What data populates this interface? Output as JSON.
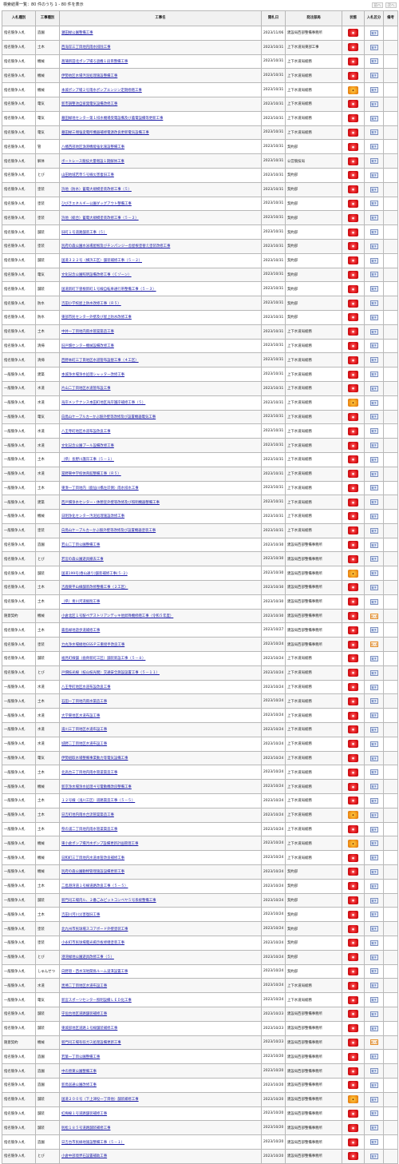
{
  "header": {
    "summary": "検索結果一覧：80 件のうち 1 - 80 件を表示",
    "prev_label": "前へ",
    "next_label": "次へ"
  },
  "columns": {
    "method": "入札種別",
    "type": "工事種別",
    "name": "工事名",
    "date": "開札日",
    "dept": "発注部局",
    "status": "状態",
    "kbn": "入札区分",
    "note": "備考"
  },
  "status_colors": {
    "open": "#e0161b",
    "closed": "#f39a1d"
  },
  "rows": [
    {
      "method": "指名競争入札",
      "type": "造園",
      "name": "瀬田緑公園整備工事",
      "date": "2023/11/06",
      "dept": "建設局西部整備事務所",
      "status": "red",
      "kbn": "電子"
    },
    {
      "method": "指名競争入札",
      "type": "土木",
      "name": "西海岸三丁目地内雨水排除工事",
      "date": "2023/10/31",
      "dept": "上下水道局東部工事",
      "status": "red",
      "kbn": "電子"
    },
    {
      "method": "指名競争入札",
      "type": "機械",
      "name": "菖蒲新田北ポンプ場ろ過機１段目整備工事",
      "date": "2023/10/31",
      "dept": "上下水道局総務",
      "status": "red",
      "kbn": "電子"
    },
    {
      "method": "指名競争入札",
      "type": "機械",
      "name": "伊勢地区水場汚泥処理施設整備工事",
      "date": "2023/10/31",
      "dept": "上下水道局総務",
      "status": "red",
      "kbn": "電子"
    },
    {
      "method": "指名競争入札",
      "type": "機械",
      "name": "本城ポンプ場２号雨水ポンプエンジン定期修繕工事",
      "date": "2023/10/31",
      "dept": "上下水道局総務",
      "status": "orange",
      "kbn": "電子"
    },
    {
      "method": "指名競争入札",
      "type": "電気",
      "name": "新市調整池自家発電気設備改修工事",
      "date": "2023/10/31",
      "dept": "上下水道局総務",
      "status": "red",
      "kbn": "電子"
    },
    {
      "method": "指名競争入札",
      "type": "電気",
      "name": "墓田緑地センター第１排水機場受電設備及び蓄電設備等更新工事",
      "date": "2023/10/31",
      "dept": "上下水道局総務",
      "status": "red",
      "kbn": "電子"
    },
    {
      "method": "指名競争入札",
      "type": "電気",
      "name": "墓田緑三増強変電所機器補修電源改良更新電気設備工事",
      "date": "2023/10/31",
      "dept": "上下水道局総務",
      "status": "red",
      "kbn": "電子"
    },
    {
      "method": "指名競争入札",
      "type": "管",
      "name": "八幡西部地区漁港機能強化施設整備工事",
      "date": "2023/10/31",
      "dept": "契約部",
      "status": "red",
      "kbn": "電子"
    },
    {
      "method": "指名競争入札",
      "type": "解体",
      "name": "ボートレース競技大量増設１期解体工事",
      "date": "2023/10/31",
      "dept": "公営競技局",
      "status": "red",
      "kbn": "電子"
    },
    {
      "method": "指名競争入札",
      "type": "とび",
      "name": "山田地域若草５号線災害復旧工事",
      "date": "2023/10/31",
      "dept": "契約部",
      "status": "red",
      "kbn": "電子"
    },
    {
      "method": "指名競争入札",
      "type": "塗装",
      "name": "浜地（防水）蓄電大規模塗装改修工事（５）",
      "date": "2023/10/31",
      "dept": "契約部",
      "status": "red",
      "kbn": "電子"
    },
    {
      "method": "指名競争入札",
      "type": "塗装",
      "name": "ひびきエネルギー公園ダッグアウト整備工事",
      "date": "2023/10/31",
      "dept": "契約部",
      "status": "red",
      "kbn": "電子"
    },
    {
      "method": "指名競争入札",
      "type": "塗装",
      "name": "浜地（総合）蓄電大規模塗装改修工事（５－２）",
      "date": "2023/10/31",
      "dept": "契約部",
      "status": "red",
      "kbn": "電子"
    },
    {
      "method": "指名競争入札",
      "type": "舗装",
      "name": "旧町１号道路舗装工事（５）",
      "date": "2023/10/31",
      "dept": "契約部",
      "status": "red",
      "kbn": "電子"
    },
    {
      "method": "指名競争入札",
      "type": "塗装",
      "name": "別府の森公園水泳場屋根及びチンパンジー舎屋根塗替え塗装改修工事",
      "date": "2023/10/31",
      "dept": "契約部",
      "status": "red",
      "kbn": "電子"
    },
    {
      "method": "指名競争入札",
      "type": "舗装",
      "name": "国道３２２号（横浜工区）舗装補修工事（５－２）",
      "date": "2023/10/31",
      "dept": "契約部",
      "status": "red",
      "kbn": "電子"
    },
    {
      "method": "指名競争入札",
      "type": "電気",
      "name": "文化記念公園照明設備改修工事（Ｃゾーン）",
      "date": "2023/10/31",
      "dept": "契約部",
      "status": "red",
      "kbn": "電子"
    },
    {
      "method": "指名競争入札",
      "type": "舗装",
      "name": "国道新町下曽根新町１号線自転車通行帯整備工事（５－３）",
      "date": "2023/10/31",
      "dept": "契約部",
      "status": "red",
      "kbn": "電子"
    },
    {
      "method": "指名競争入札",
      "type": "防水",
      "name": "吉田小学校屋上防水改修工事（Ｒ５）",
      "date": "2023/10/31",
      "dept": "契約部",
      "status": "red",
      "kbn": "電子"
    },
    {
      "method": "指名競争入札",
      "type": "防水",
      "name": "東部市民センター外壁及び屋上防水改修工事",
      "date": "2023/10/31",
      "dept": "契約部",
      "status": "red",
      "kbn": "電子"
    },
    {
      "method": "指名競争入札",
      "type": "土木",
      "name": "中井一丁目地内雨水管渠築造工事",
      "date": "2023/10/31",
      "dept": "上下水道局総務",
      "status": "red",
      "kbn": "電子"
    },
    {
      "method": "指名競争入札",
      "type": "清掃",
      "name": "旧戸畑センター機械設備改修工事",
      "date": "2023/10/31",
      "dept": "上下水道局総務",
      "status": "red",
      "kbn": "電子"
    },
    {
      "method": "指名競争入札",
      "type": "清掃",
      "name": "西野本町三丁目地区水道管布設替工事（４工区）",
      "date": "2023/10/31",
      "dept": "上下水道局総務",
      "status": "red",
      "kbn": "電子"
    },
    {
      "method": "一般競争入札",
      "type": "建築",
      "name": "本城浄水場浄水処理シャッター改修工事",
      "date": "2023/10/31",
      "dept": "上下水道局総務",
      "status": "red",
      "kbn": "電子"
    },
    {
      "method": "一般競争入札",
      "type": "水道",
      "name": "片山二丁目地区水道管布設工事",
      "date": "2023/10/31",
      "dept": "上下水道局総務",
      "status": "red",
      "kbn": "電子"
    },
    {
      "method": "一般競争入札",
      "type": "水道",
      "name": "海岸メンテナンス本田町地区海岸護岸補修工事（５）",
      "date": "2023/10/31",
      "dept": "上下水道局総務",
      "status": "orange",
      "kbn": "電子"
    },
    {
      "method": "一般競争入札",
      "type": "電気",
      "name": "白鳥山ケーブルカーかぶ駅外壁等改修及び設置機器電気工事",
      "date": "2023/10/31",
      "dept": "上下水道局総務",
      "status": "red",
      "kbn": "電子"
    },
    {
      "method": "一般競争入札",
      "type": "水道",
      "name": "八王寺町地区水道布設改良工事",
      "date": "2023/10/31",
      "dept": "上下水道局総務",
      "status": "red",
      "kbn": "電子"
    },
    {
      "method": "一般競争入札",
      "type": "水道",
      "name": "文化記念公園プール設備改修工事",
      "date": "2023/10/31",
      "dept": "上下水道局総務",
      "status": "red",
      "kbn": "電子"
    },
    {
      "method": "一般競争入札",
      "type": "土木",
      "name": "（県）長野川護岸工事（５－１）",
      "date": "2023/10/31",
      "dept": "上下水道局総務",
      "status": "red",
      "kbn": "電子"
    },
    {
      "method": "一般競争入札",
      "type": "水道",
      "name": "冨野東中学校体育館整備工事（Ｒ５）",
      "date": "2023/10/31",
      "dept": "上下水道局総務",
      "status": "red",
      "kbn": "電子"
    },
    {
      "method": "一般競争入札",
      "type": "土木",
      "name": "東湊一丁目地内（鹿仙川橋左岸側）雨水排水工事",
      "date": "2023/10/31",
      "dept": "上下水道局総務",
      "status": "red",
      "kbn": "電子"
    },
    {
      "method": "一般競争入札",
      "type": "建築",
      "name": "西戸畑浄水センター・休憩室外壁等改修及び照明機器整備工事",
      "date": "2023/10/31",
      "dept": "上下水道局総務",
      "status": "red",
      "kbn": "電子"
    },
    {
      "method": "一般競争入札",
      "type": "機械",
      "name": "日明浄化センター汚泥処理施設改修工事",
      "date": "2023/10/31",
      "dept": "上下水道局総務",
      "status": "red",
      "kbn": "電子"
    },
    {
      "method": "一般競争入札",
      "type": "塗装",
      "name": "白鳥山ケーブルカーかぶ駅外壁等改修及び設置機器塗装工事",
      "date": "2023/10/31",
      "dept": "上下水道局総務",
      "status": "red",
      "kbn": "電子"
    },
    {
      "method": "指名競争入札",
      "type": "造園",
      "name": "若山二丁目公園整備工事",
      "date": "2023/10/30",
      "dept": "建設局西部整備事務所",
      "status": "red",
      "kbn": "電子"
    },
    {
      "method": "指名競争入札",
      "type": "とび",
      "name": "若宮の森公園遊具撤去工事",
      "date": "2023/10/30",
      "dept": "建設局西部整備事務所",
      "status": "red",
      "kbn": "電子"
    },
    {
      "method": "指名競争入札",
      "type": "舗装",
      "name": "国道199号(春山通り)舗装補修工事(５-２)",
      "date": "2023/10/30",
      "dept": "建設局西部整備事務所",
      "status": "orange",
      "kbn": "電子"
    },
    {
      "method": "指名競争入札",
      "type": "土木",
      "name": "吉鹿東平山線舗装改修整備工事（２工区）",
      "date": "2023/10/30",
      "dept": "建設局西部整備事務所",
      "status": "red",
      "kbn": "電子"
    },
    {
      "method": "指名競争入札",
      "type": "土木",
      "name": "（県）青川河道掘削工事",
      "date": "2023/10/30",
      "dept": "建設局西部整備事務所",
      "status": "red",
      "kbn": "電子"
    },
    {
      "method": "随意契約",
      "type": "機械",
      "name": "小倉北区１号駅ペデストリアンデッキ他昇降機修繕工事（令和５年度）",
      "date": "2023/10/30",
      "dept": "建設局西部整備事務所",
      "status": "red",
      "kbn": "紙入札"
    },
    {
      "method": "指名競争入札",
      "type": "土木",
      "name": "霧島緑地遊歩道補修工事",
      "date": "2023/10/27",
      "dept": "建設局西部整備事務所",
      "status": "red",
      "kbn": "電子"
    },
    {
      "method": "指名競争入札",
      "type": "塗装",
      "name": "力丸浄水場緑地GSSＰ三重接手改良工事",
      "date": "2023/10/24",
      "dept": "建設局西部整備事務所",
      "status": "red",
      "kbn": "紙入札"
    },
    {
      "method": "指名競争入札",
      "type": "舗装",
      "name": "福見町線舗（歯骨新町工区）舗装新設工事（５－８）",
      "date": "2023/10/24",
      "dept": "上下水道局総務",
      "status": "red",
      "kbn": "電子"
    },
    {
      "method": "指名競争入札",
      "type": "とび",
      "name": "戸畑枝光線（枝山枝光間）交通安全施設設置工事（５－１１）",
      "date": "2023/10/24",
      "dept": "上下水道局総務",
      "status": "red",
      "kbn": "電子"
    },
    {
      "method": "一般競争入札",
      "type": "水道",
      "name": "八王寺町地区水道布設改良工事",
      "date": "2023/10/24",
      "dept": "上下水道局総務",
      "status": "red",
      "kbn": "電子"
    },
    {
      "method": "一般競争入札",
      "type": "土木",
      "name": "石田一丁目地内雨水築造工事",
      "date": "2023/10/24",
      "dept": "上下水道局総務",
      "status": "red",
      "kbn": "電子"
    },
    {
      "method": "一般競争入札",
      "type": "水道",
      "name": "大学東地区水道布設工事",
      "date": "2023/10/24",
      "dept": "上下水道局総務",
      "status": "red",
      "kbn": "電子"
    },
    {
      "method": "一般競争入札",
      "type": "水道",
      "name": "湯川三丁目地区水道布設工事",
      "date": "2023/10/24",
      "dept": "上下水道局総務",
      "status": "red",
      "kbn": "電子"
    },
    {
      "method": "一般競争入札",
      "type": "水道",
      "name": "城野二丁目地区水道布設工事",
      "date": "2023/10/24",
      "dept": "上下水道局総務",
      "status": "red",
      "kbn": "電子"
    },
    {
      "method": "一般競争入札",
      "type": "電気",
      "name": "伊勢組取水場整備事業動力等電気設備工事",
      "date": "2023/10/24",
      "dept": "上下水道局総務",
      "status": "red",
      "kbn": "電子"
    },
    {
      "method": "一般競争入札",
      "type": "土木",
      "name": "北高台三丁目地内雨水管渠築造工事",
      "date": "2023/10/24",
      "dept": "上下水道局総務",
      "status": "red",
      "kbn": "電子"
    },
    {
      "method": "一般競争入札",
      "type": "機械",
      "name": "新京浄水場浄水処理４号電動機改良整備工事",
      "date": "2023/10/24",
      "dept": "上下水道局総務",
      "status": "red",
      "kbn": "電子"
    },
    {
      "method": "一般競争入札",
      "type": "土木",
      "name": "１２号線（浅川工区）道路築造工事（５－５）",
      "date": "2023/10/24",
      "dept": "上下水道局総務",
      "status": "red",
      "kbn": "電子"
    },
    {
      "method": "一般競争入札",
      "type": "土木",
      "name": "日吉町地内雨水合流管渠築造工事",
      "date": "2023/10/24",
      "dept": "上下水道局総務",
      "status": "orange",
      "kbn": "電子"
    },
    {
      "method": "一般競争入札",
      "type": "土木",
      "name": "祭の浦二丁目地内雨水管渠築造工事",
      "date": "2023/10/24",
      "dept": "上下水道局総務",
      "status": "red",
      "kbn": "電子"
    },
    {
      "method": "一般競争入札",
      "type": "機械",
      "name": "東小倉ポンプ場汚水ポンプ設備更新計画管理工事",
      "date": "2023/10/24",
      "dept": "上下水道局総務",
      "status": "orange",
      "kbn": "電子"
    },
    {
      "method": "一般競争入札",
      "type": "機械",
      "name": "日和町三丁目地内水道本管改良補修工事",
      "date": "2023/10/24",
      "dept": "上下水道局総務",
      "status": "red",
      "kbn": "電子"
    },
    {
      "method": "一般競争入札",
      "type": "機械",
      "name": "別府の森公園動物管理施設設備更新工事",
      "date": "2023/10/24",
      "dept": "契約部",
      "status": "red",
      "kbn": "電子"
    },
    {
      "method": "一般競争入札",
      "type": "土木",
      "name": "二島港湾道１号線道路改良工事（５－５）",
      "date": "2023/10/24",
      "dept": "契約部",
      "status": "red",
      "kbn": "電子"
    },
    {
      "method": "一般競争入札",
      "type": "舗装",
      "name": "新門司工場内ル、２番ごみピットコンベヤ５号系統整備工事",
      "date": "2023/10/24",
      "dept": "契約部",
      "status": "red",
      "kbn": "電子"
    },
    {
      "method": "一般競争入札",
      "type": "土木",
      "name": "吉田川河川災害復旧工事",
      "date": "2023/10/24",
      "dept": "契約部",
      "status": "red",
      "kbn": "電子"
    },
    {
      "method": "一般競争入札",
      "type": "塗装",
      "name": "北九州市民球場スコアボード外壁塗装工事",
      "date": "2023/10/24",
      "dept": "契約部",
      "status": "red",
      "kbn": "電子"
    },
    {
      "method": "一般競争入札",
      "type": "塗装",
      "name": "小永町市民球場電光掲示板修繕塗装工事",
      "date": "2023/10/24",
      "dept": "契約部",
      "status": "red",
      "kbn": "電子"
    },
    {
      "method": "一般競争入札",
      "type": "とび",
      "name": "港湾緑地公園遊具改修工事（５）",
      "date": "2023/10/24",
      "dept": "契約部",
      "status": "red",
      "kbn": "電子"
    },
    {
      "method": "一般競争入札",
      "type": "しゅんせつ",
      "name": "白野港・西水深地関係ルーム浚渫設置工事",
      "date": "2023/10/24",
      "dept": "契約部",
      "status": "red",
      "kbn": "電子"
    },
    {
      "method": "一般競争入札",
      "type": "水道",
      "name": "黒埼二丁目地区水道布設工事",
      "date": "2023/10/24",
      "dept": "上下水道局総務",
      "status": "red",
      "kbn": "電子"
    },
    {
      "method": "一般競争入札",
      "type": "電気",
      "name": "新宮スポーツセンター照明設備ＬＥＤ化工事",
      "date": "2023/10/24",
      "dept": "上下水道局総務",
      "status": "red",
      "kbn": "電子"
    },
    {
      "method": "指名競争入札",
      "type": "舗装",
      "name": "守垣台地区道路舗装補修工事",
      "date": "2023/10/23",
      "dept": "建設局西部整備事務所",
      "status": "red",
      "kbn": "電子"
    },
    {
      "method": "指名競争入札",
      "type": "舗装",
      "name": "東城部地区道路１号線舗装補修工事",
      "date": "2023/10/23",
      "dept": "建設局西部整備事務所",
      "status": "red",
      "kbn": "電子"
    },
    {
      "method": "随意契約",
      "type": "機械",
      "name": "新門司工場有収ガス処理設備更新工事",
      "date": "2023/10/23",
      "dept": "建設局西部整備事務所",
      "status": "red",
      "kbn": "紙入札"
    },
    {
      "method": "指名競争入札",
      "type": "造園",
      "name": "若葉一丁目公園整備工事",
      "date": "2023/10/20",
      "dept": "建設局西部整備事務所",
      "status": "red",
      "kbn": "電子"
    },
    {
      "method": "指名競争入札",
      "type": "造園",
      "name": "中の原東公園整備工事",
      "date": "2023/10/20",
      "dept": "建設局西部整備事務所",
      "status": "red",
      "kbn": "電子"
    },
    {
      "method": "指名競争入札",
      "type": "造園",
      "name": "新鳥居通公園改修工事",
      "date": "2023/10/20",
      "dept": "建設局西部整備事務所",
      "status": "red",
      "kbn": "電子"
    },
    {
      "method": "指名競争入札",
      "type": "舗装",
      "name": "国道２００号（下上津役一丁目他）舗装補修工事",
      "date": "2023/10/20",
      "dept": "建設局西部整備事務所",
      "status": "orange",
      "kbn": "電子"
    },
    {
      "method": "指名競争入札",
      "type": "舗装",
      "name": "紅梅線１号道路舗装補修工事",
      "date": "2023/10/20",
      "dept": "建設局西部整備事務所",
      "status": "red",
      "kbn": "電子"
    },
    {
      "method": "指名競争入札",
      "type": "舗装",
      "name": "則松１８５号道路舗装補修工事",
      "date": "2023/10/20",
      "dept": "建設局西部整備事務所",
      "status": "red",
      "kbn": "電子"
    },
    {
      "method": "指名競争入札",
      "type": "造園",
      "name": "日吉台市民緑地施設整備工事（５－１）",
      "date": "2023/10/20",
      "dept": "建設局西部整備事務所",
      "status": "red",
      "kbn": "電子"
    },
    {
      "method": "指名競争入札",
      "type": "とび",
      "name": "小倉中部境界石設置補助工事",
      "date": "2023/10/20",
      "dept": "建設局西部整備事務所",
      "status": "red",
      "kbn": "電子"
    }
  ]
}
